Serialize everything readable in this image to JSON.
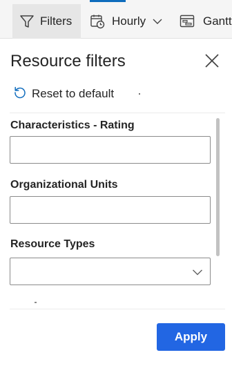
{
  "toolbar": {
    "filters_label": "Filters",
    "hourly_label": "Hourly",
    "gantt_label": "Gantt",
    "accent_color": "#0f6cbd"
  },
  "panel": {
    "title": "Resource filters",
    "reset_label": "Reset to default",
    "fields": [
      {
        "label": "Characteristics - Rating",
        "value": ""
      },
      {
        "label": "Organizational Units",
        "value": ""
      },
      {
        "label": "Resource Types",
        "value": ""
      }
    ]
  },
  "footer": {
    "apply_label": "Apply",
    "apply_color": "#2266e3"
  },
  "icons": {
    "filters": "filter-funnel-icon",
    "hourly": "calendar-clock-icon",
    "gantt": "gantt-chart-icon",
    "close": "close-icon",
    "reset": "reset-arrow-icon",
    "more": "more-horizontal-icon",
    "dropdown": "chevron-down-icon"
  }
}
